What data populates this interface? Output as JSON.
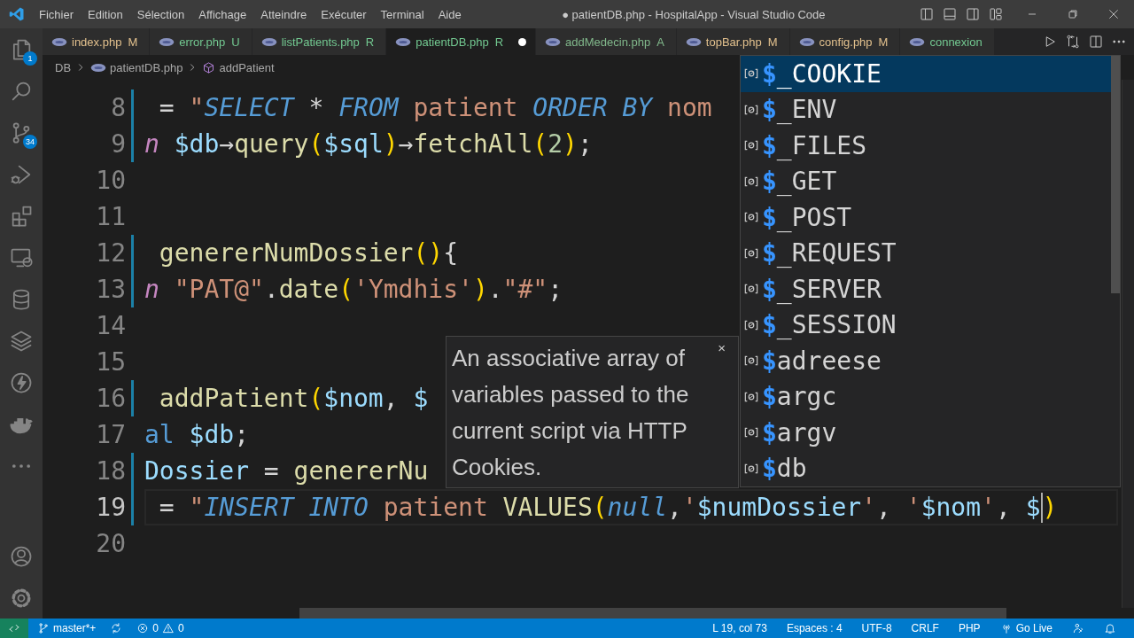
{
  "window": {
    "title": "● patientDB.php - HospitalApp - Visual Studio Code"
  },
  "menu": [
    "Fichier",
    "Edition",
    "Sélection",
    "Affichage",
    "Atteindre",
    "Exécuter",
    "Terminal",
    "Aide"
  ],
  "activity_bar": {
    "items": [
      {
        "kind": "explorer",
        "badge": "1"
      },
      {
        "kind": "search"
      },
      {
        "kind": "source-control",
        "badge": "34"
      },
      {
        "kind": "run"
      },
      {
        "kind": "extensions"
      },
      {
        "kind": "remote"
      },
      {
        "kind": "database"
      },
      {
        "kind": "layers"
      },
      {
        "kind": "lightning"
      },
      {
        "kind": "docker"
      },
      {
        "kind": "more"
      }
    ],
    "bottom": [
      {
        "kind": "account"
      },
      {
        "kind": "settings"
      }
    ]
  },
  "tabs": [
    {
      "label": "index.php",
      "status": "M",
      "color": "#e2c08d",
      "selected": false,
      "modified": false
    },
    {
      "label": "error.php",
      "status": "U",
      "color": "#73c991",
      "selected": false,
      "modified": false
    },
    {
      "label": "listPatients.php",
      "status": "R",
      "color": "#73c991",
      "selected": false,
      "modified": false
    },
    {
      "label": "patientDB.php",
      "status": "R",
      "color": "#73c991",
      "selected": true,
      "modified": true
    },
    {
      "label": "addMedecin.php",
      "status": "A",
      "color": "#81b88b",
      "selected": false,
      "modified": false
    },
    {
      "label": "topBar.php",
      "status": "M",
      "color": "#e2c08d",
      "selected": false,
      "modified": false
    },
    {
      "label": "config.php",
      "status": "M",
      "color": "#e2c08d",
      "selected": false,
      "modified": false
    },
    {
      "label": "connexion",
      "color": "#73c991",
      "selected": false,
      "modified": false
    }
  ],
  "breadcrumb": [
    {
      "kind": "folder",
      "text": "DB"
    },
    {
      "kind": "file",
      "text": "patientDB.php"
    },
    {
      "kind": "method",
      "text": "addPatient"
    }
  ],
  "lines": [
    {
      "number": "8",
      "current": false,
      "changed": true,
      "tokens": [
        {
          "text": " = ",
          "kind": "plain"
        },
        {
          "text": "\"",
          "kind": "string"
        },
        {
          "text": "SELECT",
          "kind": "sql"
        },
        {
          "text": " * ",
          "kind": "plain"
        },
        {
          "text": "FROM",
          "kind": "sql"
        },
        {
          "text": " patient ",
          "kind": "string"
        },
        {
          "text": "ORDER BY",
          "kind": "sql"
        },
        {
          "text": " nom",
          "kind": "string"
        }
      ]
    },
    {
      "number": "9",
      "current": false,
      "changed": true,
      "tokens": [
        {
          "text": "n",
          "kind": "keyword"
        },
        {
          "text": " $db",
          "kind": "var"
        },
        {
          "text": "→",
          "kind": "plain"
        },
        {
          "text": "query",
          "kind": "func"
        },
        {
          "text": "(",
          "kind": "paren"
        },
        {
          "text": "$sql",
          "kind": "var"
        },
        {
          "text": ")",
          "kind": "paren"
        },
        {
          "text": "→",
          "kind": "plain"
        },
        {
          "text": "fetchAll",
          "kind": "func"
        },
        {
          "text": "(",
          "kind": "paren"
        },
        {
          "text": "2",
          "kind": "number"
        },
        {
          "text": ")",
          "kind": "paren"
        },
        {
          "text": ";",
          "kind": "plain"
        }
      ]
    },
    {
      "number": "10",
      "current": false,
      "changed": false
    },
    {
      "number": "11",
      "current": false,
      "changed": false
    },
    {
      "number": "12",
      "current": false,
      "changed": true,
      "tokens": [
        {
          "text": " genererNumDossier",
          "kind": "func"
        },
        {
          "text": "()",
          "kind": "paren"
        },
        {
          "text": "{",
          "kind": "plain"
        }
      ]
    },
    {
      "number": "13",
      "current": false,
      "changed": true,
      "tokens": [
        {
          "text": "n",
          "kind": "keyword"
        },
        {
          "text": " \"PAT@\"",
          "kind": "string"
        },
        {
          "text": ".",
          "kind": "plain"
        },
        {
          "text": "date",
          "kind": "func"
        },
        {
          "text": "(",
          "kind": "paren"
        },
        {
          "text": "'Ymdhis'",
          "kind": "string"
        },
        {
          "text": ")",
          "kind": "paren"
        },
        {
          "text": ".",
          "kind": "plain"
        },
        {
          "text": "\"#\"",
          "kind": "string"
        },
        {
          "text": ";",
          "kind": "plain"
        }
      ]
    },
    {
      "number": "14",
      "current": false,
      "changed": false
    },
    {
      "number": "15",
      "current": false,
      "changed": false
    },
    {
      "number": "16",
      "current": false,
      "changed": true,
      "tokens": [
        {
          "text": " addPatient",
          "kind": "func"
        },
        {
          "text": "(",
          "kind": "paren"
        },
        {
          "text": "$nom",
          "kind": "var"
        },
        {
          "text": ", ",
          "kind": "plain"
        },
        {
          "text": "$",
          "kind": "var"
        }
      ]
    },
    {
      "number": "17",
      "current": false,
      "changed": false,
      "tokens": [
        {
          "text": "al",
          "kind": "storage"
        },
        {
          "text": " $db",
          "kind": "var"
        },
        {
          "text": ";",
          "kind": "plain"
        }
      ]
    },
    {
      "number": "18",
      "current": false,
      "changed": true,
      "tokens": [
        {
          "text": "Dossier",
          "kind": "var"
        },
        {
          "text": " = ",
          "kind": "plain"
        },
        {
          "text": "genererNu",
          "kind": "func"
        }
      ]
    },
    {
      "number": "19",
      "current": true,
      "changed": true,
      "tokens": [
        {
          "text": " = ",
          "kind": "plain"
        },
        {
          "text": "\"",
          "kind": "string"
        },
        {
          "text": "INSERT INTO",
          "kind": "sql"
        },
        {
          "text": " patient ",
          "kind": "string"
        },
        {
          "text": "VALUES",
          "kind": "func"
        },
        {
          "text": "(",
          "kind": "paren"
        },
        {
          "text": "null",
          "kind": "constant"
        },
        {
          "text": ",",
          "kind": "plain"
        },
        {
          "text": "'",
          "kind": "string"
        },
        {
          "text": "$numDossier",
          "kind": "var"
        },
        {
          "text": "'",
          "kind": "string"
        },
        {
          "text": ",",
          "kind": "plain"
        },
        {
          "text": " '",
          "kind": "string"
        },
        {
          "text": "$nom",
          "kind": "var"
        },
        {
          "text": "'",
          "kind": "string"
        },
        {
          "text": ", ",
          "kind": "plain"
        },
        {
          "text": "$",
          "kind": "var",
          "caret": true
        },
        {
          "text": ")",
          "kind": "paren"
        }
      ]
    },
    {
      "number": "20",
      "current": false,
      "changed": false
    }
  ],
  "hover": {
    "text": "An associative array of variables passed to the current script via HTTP Cookies.",
    "close": "×"
  },
  "suggestions": [
    {
      "sigil": "$",
      "name": "_COOKIE",
      "selected": true
    },
    {
      "sigil": "$",
      "name": "_ENV",
      "selected": false
    },
    {
      "sigil": "$",
      "name": "_FILES",
      "selected": false
    },
    {
      "sigil": "$",
      "name": "_GET",
      "selected": false
    },
    {
      "sigil": "$",
      "name": "_POST",
      "selected": false
    },
    {
      "sigil": "$",
      "name": "_REQUEST",
      "selected": false
    },
    {
      "sigil": "$",
      "name": "_SERVER",
      "selected": false
    },
    {
      "sigil": "$",
      "name": "_SESSION",
      "selected": false
    },
    {
      "sigil": "$",
      "name": "adreese",
      "selected": false
    },
    {
      "sigil": "$",
      "name": "argc",
      "selected": false
    },
    {
      "sigil": "$",
      "name": "argv",
      "selected": false
    },
    {
      "sigil": "$",
      "name": "db",
      "selected": false
    }
  ],
  "status_bar": {
    "left": [
      {
        "kind": "remote"
      },
      {
        "kind": "branch",
        "text": "master*+"
      },
      {
        "kind": "sync"
      },
      {
        "kind": "problems",
        "errors": "0",
        "warnings": "0"
      }
    ],
    "right": [
      {
        "kind": "text",
        "text": "L 19, col 73"
      },
      {
        "kind": "text",
        "text": "Espaces : 4"
      },
      {
        "kind": "text",
        "text": "UTF-8"
      },
      {
        "kind": "text",
        "text": "CRLF"
      },
      {
        "kind": "text",
        "text": "PHP"
      },
      {
        "kind": "golive",
        "text": "Go Live"
      },
      {
        "kind": "feedback"
      },
      {
        "kind": "bell"
      }
    ]
  }
}
